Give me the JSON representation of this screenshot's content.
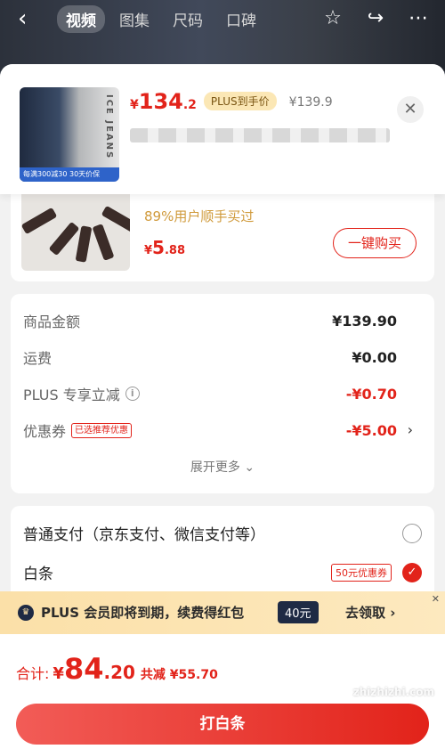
{
  "top_nav": {
    "back_icon": "chevron-left-icon",
    "tabs": [
      {
        "label": "视频",
        "active": true
      },
      {
        "label": "图集",
        "active": false
      },
      {
        "label": "尺码",
        "active": false
      },
      {
        "label": "口碑",
        "active": false
      }
    ],
    "icons": [
      "star-icon",
      "share-icon",
      "more-icon"
    ]
  },
  "product": {
    "brand_text": "ICE JEANS",
    "thumb_strip_text": "每满300减30 30天价保",
    "price_yen": "¥",
    "price_int": "134",
    "price_dec": ".2",
    "plus_tag": "PLUS到手价",
    "orig_price": "¥139.9"
  },
  "recommend": {
    "title": "",
    "subtitle": "89%用户顺手买过",
    "price_yen": "¥",
    "price_int": "5",
    "price_dec": ".88",
    "buy_label": "一键购买"
  },
  "price_detail": {
    "rows": [
      {
        "label": "商品金额",
        "value": "¥139.90"
      },
      {
        "label": "运费",
        "value": "¥0.00"
      },
      {
        "label": "PLUS 专享立减",
        "value": "-¥0.70"
      },
      {
        "label": "优惠券",
        "tag": "已选推荐优惠",
        "value": "-¥5.00"
      }
    ],
    "expand_label": "展开更多 ⌄"
  },
  "payment": {
    "option1": "普通支付（京东支付、微信支付等）",
    "option2": "白条",
    "option2_tag": "50元优惠券"
  },
  "banner": {
    "text": "PLUS 会员即将到期，续费得红包",
    "amount": "40元",
    "claim": "去领取 ›"
  },
  "bottom": {
    "total_label": "合计:",
    "total_yen": "¥",
    "total_int": "84",
    "total_dec": ".20",
    "save_text": "共减 ¥55.70",
    "pay_label": "打白条",
    "watermark": "zhizhizhi.com"
  },
  "colors": {
    "accent": "#e2231a",
    "plus_gold": "#fbe7b5",
    "banner": "#fbe0a8"
  }
}
